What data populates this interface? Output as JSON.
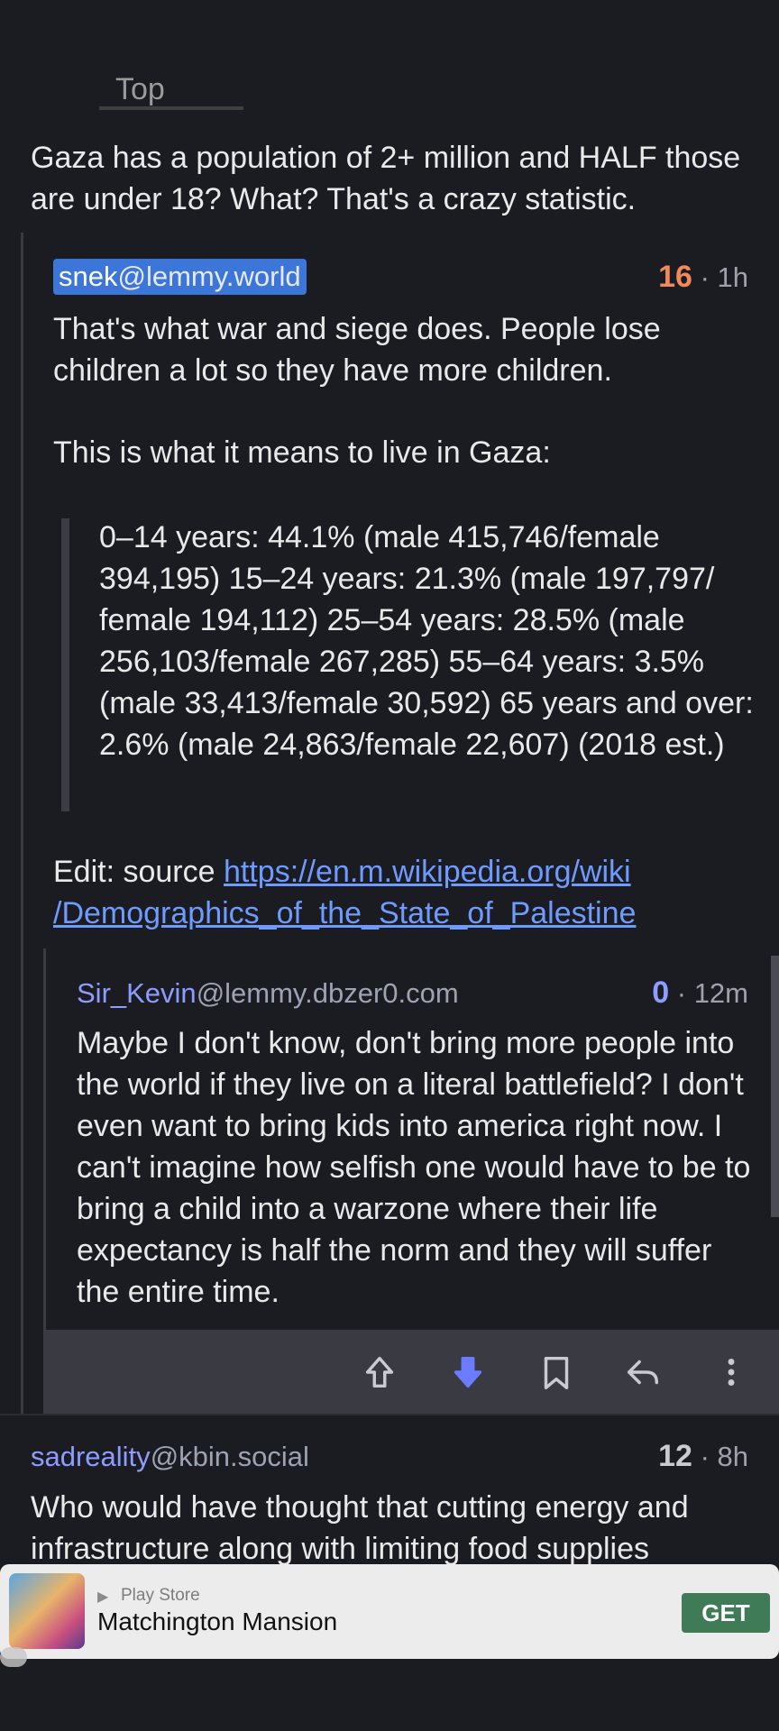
{
  "top_clipped_text": "Top",
  "parent_comment_text": "Gaza has a population of 2+ million and HALF those are under 18? What? That's a crazy statistic.",
  "comment1": {
    "user_name": "snek",
    "user_instance": "@lemmy.world",
    "score": "16",
    "time": "1h",
    "para1": "That's what war and siege does. People lose children a lot so they have more children.",
    "para2": "This is what it means to live in Gaza:",
    "quote": "0–14 years: 44.1% (male 415,746/female 394,195) 15–24 years: 21.3% (male 197,797/ female 194,112) 25–54 years: 28.5% (male 256,103/female 267,285) 55–64 years: 3.5% (male 33,413/female 30,592) 65 years and over: 2.6% (male 24,863/female 22,607) (2018 est.)",
    "edit_prefix": "Edit: source ",
    "link_text": "https://en.m.wikipedia.org/wiki /Demographics_of_the_State_of_Palestine"
  },
  "comment2": {
    "user_name": "Sir_Kevin",
    "user_instance": "@lemmy.dbzer0.com",
    "score": "0",
    "time": "12m",
    "text": "Maybe I don't know, don't bring more people into the world if they live on a literal battlefield? I don't even want to bring kids into america right now. I can't imagine how selfish one would have to be to bring a child into a warzone where their life expectancy is half the norm and they will suffer the entire time."
  },
  "comment3": {
    "user_name": "sadreality",
    "user_instance": "@kbin.social",
    "score": "12",
    "time": "8h",
    "text": "Who would have thought that cutting energy and infrastructure along with limiting food supplies"
  },
  "meta_separator": "·",
  "actions": [
    "upvote",
    "downvote",
    "save",
    "reply",
    "more"
  ],
  "ad": {
    "store": "Play Store",
    "title": "Matchington Mansion",
    "cta": "GET"
  },
  "colors": {
    "background": "#1b1c21",
    "accent": "#8d9cff",
    "score_positive": "#f08a5d",
    "link": "#6f9bff",
    "downvote_active": "#6b7cff"
  }
}
